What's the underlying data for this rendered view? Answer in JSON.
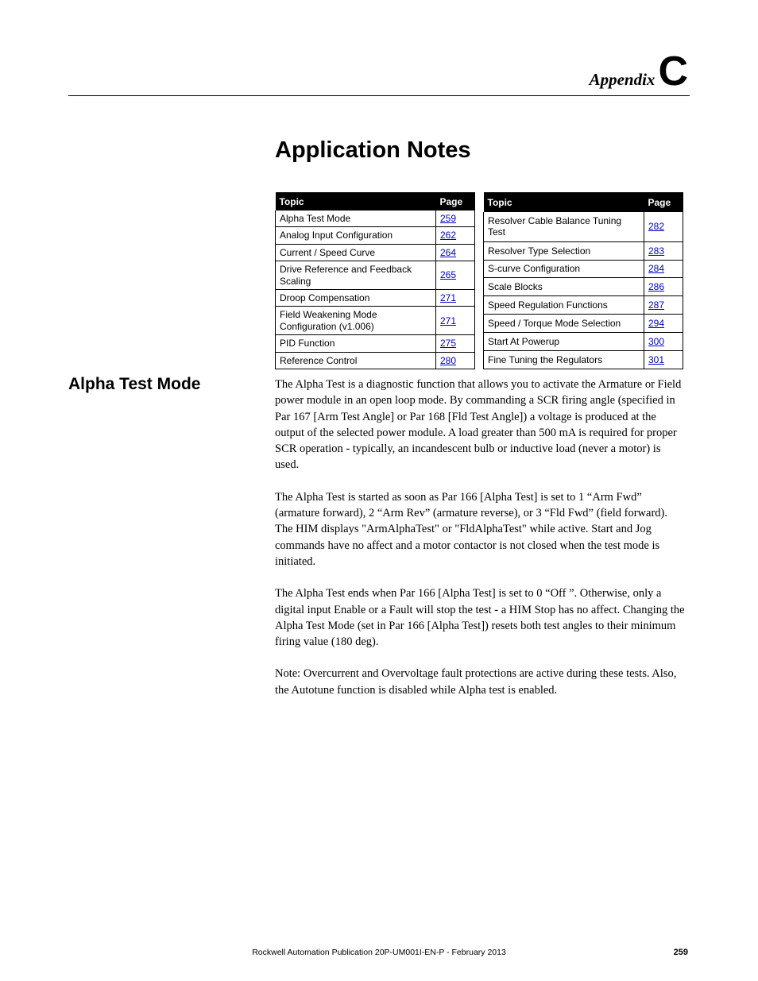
{
  "header": {
    "appendix_label": "Appendix",
    "appendix_letter": "C"
  },
  "title": "Application Notes",
  "toc": {
    "topic_header": "Topic",
    "page_header": "Page",
    "left": [
      {
        "topic": "Alpha Test Mode",
        "page": "259"
      },
      {
        "topic": "Analog Input Configuration",
        "page": "262"
      },
      {
        "topic": "Current / Speed Curve",
        "page": "264"
      },
      {
        "topic": "Drive Reference and Feedback Scaling",
        "page": "265"
      },
      {
        "topic": "Droop Compensation",
        "page": "271"
      },
      {
        "topic": "Field Weakening Mode Configuration (v1.006)",
        "page": "271"
      },
      {
        "topic": "PID Function",
        "page": "275"
      },
      {
        "topic": "Reference Control",
        "page": "280"
      }
    ],
    "right": [
      {
        "topic": "Resolver Cable Balance Tuning Test",
        "page": "282"
      },
      {
        "topic": "Resolver Type Selection",
        "page": "283"
      },
      {
        "topic": "S-curve Configuration",
        "page": "284"
      },
      {
        "topic": "Scale Blocks",
        "page": "286"
      },
      {
        "topic": "Speed Regulation Functions",
        "page": "287"
      },
      {
        "topic": "Speed / Torque Mode Selection",
        "page": "294"
      },
      {
        "topic": "Start At Powerup",
        "page": "300"
      },
      {
        "topic": "Fine Tuning the Regulators",
        "page": "301"
      }
    ]
  },
  "section": {
    "heading": "Alpha Test Mode",
    "paragraphs": {
      "p1": "The Alpha Test is a diagnostic function that allows you to activate the Armature or Field power module in an open loop mode. By commanding a SCR firing angle (specified in Par 167 [Arm Test Angle] or Par 168 [Fld Test Angle]) a voltage is produced at the output of the selected power module. A load greater than 500 mA is required for proper SCR operation - typically, an incandescent bulb or inductive load (never a motor) is used.",
      "p2": "The Alpha Test is started as soon as Par 166 [Alpha Test] is set to 1 “Arm Fwd” (armature forward), 2 “Arm Rev” (armature reverse), or 3 “Fld Fwd” (field forward). The HIM displays \"ArmAlphaTest\" or \"FldAlphaTest\" while active. Start and Jog commands have no affect and a motor contactor is not closed when the test mode is initiated.",
      "p3": "The Alpha Test ends when Par 166 [Alpha Test] is set to 0 “Off ”. Otherwise, only a digital input Enable or a Fault will stop the test - a HIM Stop has no affect. Changing the Alpha Test Mode (set in Par 166 [Alpha Test]) resets both test angles to their minimum firing value (180 deg).",
      "p4": "Note: Overcurrent and Overvoltage fault protections are active during these tests. Also, the Autotune function is disabled while Alpha test is enabled."
    }
  },
  "footer": {
    "publication": "Rockwell Automation Publication 20P-UM001I-EN-P - February 2013",
    "page_number": "259"
  }
}
